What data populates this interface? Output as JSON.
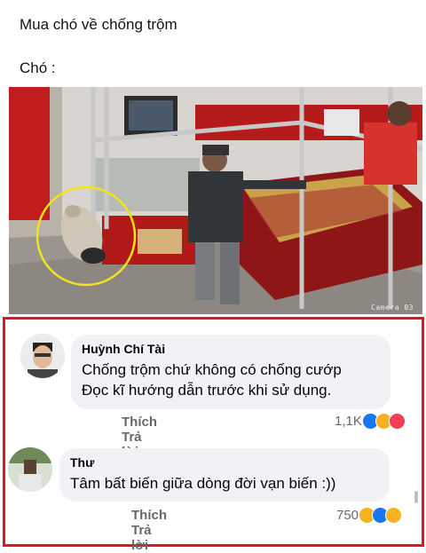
{
  "post": {
    "line1": "Mua chó về chống trộm",
    "line2": "Chó :",
    "camera_label": "Camera 03"
  },
  "comments": [
    {
      "author": "Huỳnh Chí Tài",
      "text_line1": "Chống trộm chứ không có chống cướp",
      "text_line2": "Đọc kĩ hướng dẫn trước khi sử dụng.",
      "like_label": "Thích",
      "reply_label": "Trả lời",
      "reaction_count": "1,1K",
      "reactions": [
        "like-icon",
        "haha-icon",
        "love-icon"
      ]
    },
    {
      "author": "Thư",
      "text_line1": "Tâm bất biến giữa dòng đời vạn biến :))",
      "like_label": "Thích",
      "reply_label": "Trả lời",
      "reaction_count": "750",
      "reactions": [
        "haha-icon",
        "like-icon",
        "sad-icon"
      ]
    }
  ],
  "colors": {
    "highlight_frame": "#e3151a",
    "bubble": "#f0f2f5",
    "like": "#1877f2",
    "love": "#f33e58",
    "haha": "#f7b125"
  }
}
